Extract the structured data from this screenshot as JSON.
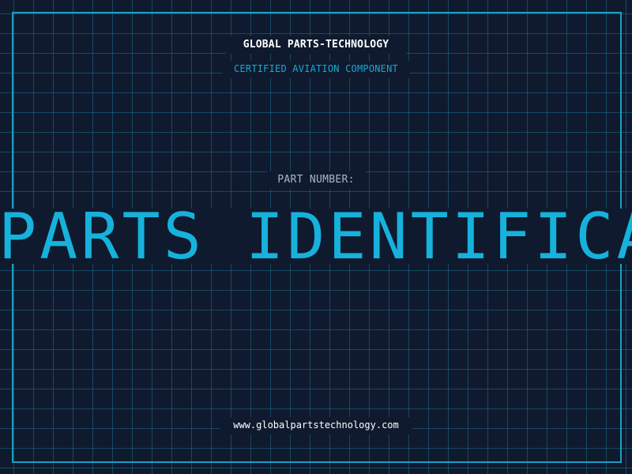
{
  "brand": "GLOBAL PARTS-TECHNOLOGY",
  "subtitle": "CERTIFIED AVIATION COMPONENT",
  "part_number_label": "PART NUMBER:",
  "headline": "PARTS IDENTIFICATI",
  "website": "www.globalpartstechnology.com",
  "colors": {
    "background": "#0f1a2e",
    "accent": "#16b2dc",
    "grid": "#206e8c"
  }
}
